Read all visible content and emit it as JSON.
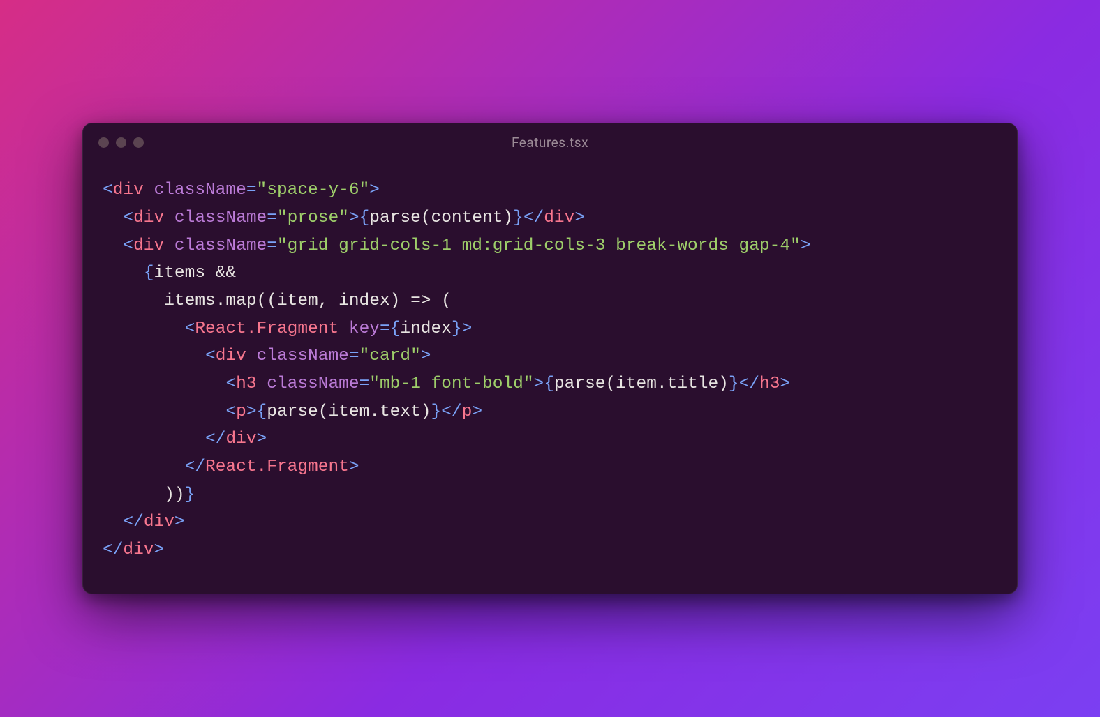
{
  "window": {
    "title": "Features.tsx"
  },
  "code": {
    "lines": [
      [
        {
          "c": "p",
          "t": "<"
        },
        {
          "c": "tg",
          "t": "div"
        },
        {
          "c": "tx",
          "t": " "
        },
        {
          "c": "at",
          "t": "className"
        },
        {
          "c": "eq",
          "t": "="
        },
        {
          "c": "st",
          "t": "\"space-y-6\""
        },
        {
          "c": "p",
          "t": ">"
        }
      ],
      [
        {
          "c": "tx",
          "t": "  "
        },
        {
          "c": "p",
          "t": "<"
        },
        {
          "c": "tg",
          "t": "div"
        },
        {
          "c": "tx",
          "t": " "
        },
        {
          "c": "at",
          "t": "className"
        },
        {
          "c": "eq",
          "t": "="
        },
        {
          "c": "st",
          "t": "\"prose\""
        },
        {
          "c": "p",
          "t": ">"
        },
        {
          "c": "p",
          "t": "{"
        },
        {
          "c": "tx",
          "t": "parse(content)"
        },
        {
          "c": "p",
          "t": "}"
        },
        {
          "c": "p",
          "t": "</"
        },
        {
          "c": "tg",
          "t": "div"
        },
        {
          "c": "p",
          "t": ">"
        }
      ],
      [
        {
          "c": "tx",
          "t": "  "
        },
        {
          "c": "p",
          "t": "<"
        },
        {
          "c": "tg",
          "t": "div"
        },
        {
          "c": "tx",
          "t": " "
        },
        {
          "c": "at",
          "t": "className"
        },
        {
          "c": "eq",
          "t": "="
        },
        {
          "c": "st",
          "t": "\"grid grid-cols-1 md:grid-cols-3 break-words gap-4\""
        },
        {
          "c": "p",
          "t": ">"
        }
      ],
      [
        {
          "c": "tx",
          "t": "    "
        },
        {
          "c": "p",
          "t": "{"
        },
        {
          "c": "tx",
          "t": "items &&"
        }
      ],
      [
        {
          "c": "tx",
          "t": "      items.map((item, index) => ("
        }
      ],
      [
        {
          "c": "tx",
          "t": "        "
        },
        {
          "c": "p",
          "t": "<"
        },
        {
          "c": "tg",
          "t": "React.Fragment"
        },
        {
          "c": "tx",
          "t": " "
        },
        {
          "c": "at",
          "t": "key"
        },
        {
          "c": "eq",
          "t": "="
        },
        {
          "c": "p",
          "t": "{"
        },
        {
          "c": "tx",
          "t": "index"
        },
        {
          "c": "p",
          "t": "}"
        },
        {
          "c": "p",
          "t": ">"
        }
      ],
      [
        {
          "c": "tx",
          "t": "          "
        },
        {
          "c": "p",
          "t": "<"
        },
        {
          "c": "tg",
          "t": "div"
        },
        {
          "c": "tx",
          "t": " "
        },
        {
          "c": "at",
          "t": "className"
        },
        {
          "c": "eq",
          "t": "="
        },
        {
          "c": "st",
          "t": "\"card\""
        },
        {
          "c": "p",
          "t": ">"
        }
      ],
      [
        {
          "c": "tx",
          "t": "            "
        },
        {
          "c": "p",
          "t": "<"
        },
        {
          "c": "tg",
          "t": "h3"
        },
        {
          "c": "tx",
          "t": " "
        },
        {
          "c": "at",
          "t": "className"
        },
        {
          "c": "eq",
          "t": "="
        },
        {
          "c": "st",
          "t": "\"mb-1 font-bold\""
        },
        {
          "c": "p",
          "t": ">"
        },
        {
          "c": "p",
          "t": "{"
        },
        {
          "c": "tx",
          "t": "parse(item.title)"
        },
        {
          "c": "p",
          "t": "}"
        },
        {
          "c": "p",
          "t": "</"
        },
        {
          "c": "tg",
          "t": "h3"
        },
        {
          "c": "p",
          "t": ">"
        }
      ],
      [
        {
          "c": "tx",
          "t": "            "
        },
        {
          "c": "p",
          "t": "<"
        },
        {
          "c": "tg",
          "t": "p"
        },
        {
          "c": "p",
          "t": ">"
        },
        {
          "c": "p",
          "t": "{"
        },
        {
          "c": "tx",
          "t": "parse(item.text)"
        },
        {
          "c": "p",
          "t": "}"
        },
        {
          "c": "p",
          "t": "</"
        },
        {
          "c": "tg",
          "t": "p"
        },
        {
          "c": "p",
          "t": ">"
        }
      ],
      [
        {
          "c": "tx",
          "t": "          "
        },
        {
          "c": "p",
          "t": "</"
        },
        {
          "c": "tg",
          "t": "div"
        },
        {
          "c": "p",
          "t": ">"
        }
      ],
      [
        {
          "c": "tx",
          "t": "        "
        },
        {
          "c": "p",
          "t": "</"
        },
        {
          "c": "tg",
          "t": "React.Fragment"
        },
        {
          "c": "p",
          "t": ">"
        }
      ],
      [
        {
          "c": "tx",
          "t": "      ))"
        },
        {
          "c": "p",
          "t": "}"
        }
      ],
      [
        {
          "c": "tx",
          "t": "  "
        },
        {
          "c": "p",
          "t": "</"
        },
        {
          "c": "tg",
          "t": "div"
        },
        {
          "c": "p",
          "t": ">"
        }
      ],
      [
        {
          "c": "p",
          "t": "</"
        },
        {
          "c": "tg",
          "t": "div"
        },
        {
          "c": "p",
          "t": ">"
        }
      ]
    ]
  }
}
